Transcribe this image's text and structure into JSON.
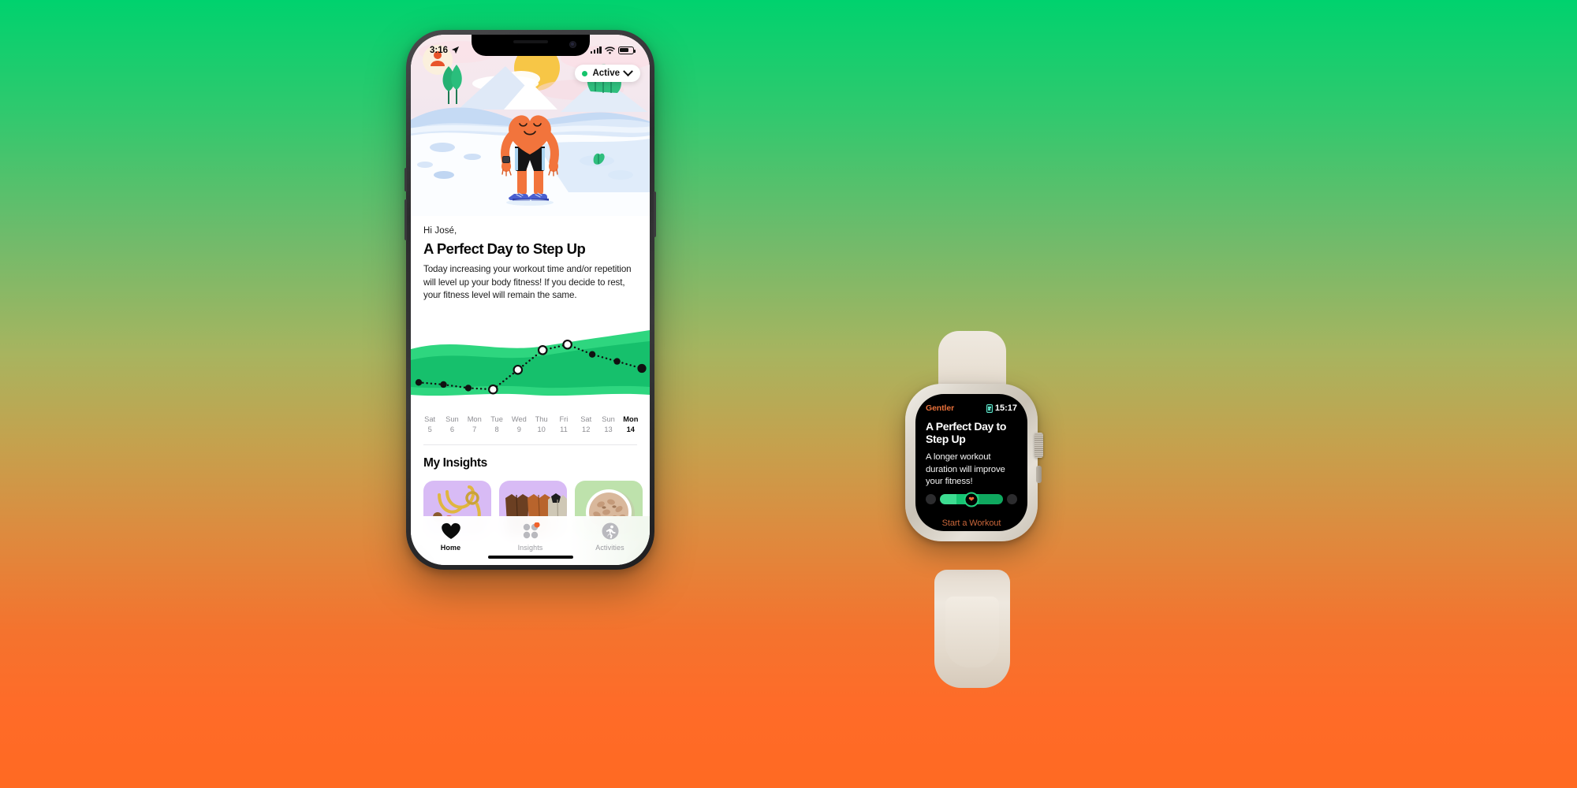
{
  "background": {
    "top_color": "#00D26E",
    "mid_color": "#C4A24E",
    "bottom_color": "#FF6B28"
  },
  "phone": {
    "status_bar": {
      "time": "3:16",
      "location_icon": "location-arrow-icon",
      "signal_icon": "cellular-signal-icon",
      "wifi_icon": "wifi-icon",
      "battery_icon": "battery-icon"
    },
    "hero": {
      "status_pill": {
        "label": "Active",
        "dot_color": "#14C46B",
        "chevron": "chevron-down-icon"
      },
      "character": "heart-mascot-illustration"
    },
    "greeting": "Hi José,",
    "headline": "A Perfect Day to Step Up",
    "body": "Today increasing your workout time and/or repetition will level up your body fitness! If you decide to rest, your fitness level will remain the same.",
    "insights": {
      "title": "My Insights",
      "cards": [
        {
          "name": "stethoscope-card",
          "bg": "#D8BBF5"
        },
        {
          "name": "coats-card",
          "bg": "#D8BBF5"
        },
        {
          "name": "nuts-bowl-card",
          "bg": "#BEE2AC"
        },
        {
          "name": "partial-card",
          "bg": "#C7E8B5"
        }
      ]
    },
    "tabs": [
      {
        "label": "Home",
        "icon": "heart-icon",
        "active": true,
        "badge": ""
      },
      {
        "label": "Insights",
        "icon": "grid-dots-icon",
        "active": false,
        "badge": "dot"
      },
      {
        "label": "Activities",
        "icon": "running-person-icon",
        "active": false,
        "badge": ""
      }
    ]
  },
  "chart_data": {
    "type": "line",
    "title": "",
    "xlabel": "",
    "ylabel": "",
    "grid": false,
    "legend": "none",
    "categories": [
      "Sat 5",
      "Sun 6",
      "Mon 7",
      "Tue 8",
      "Wed 9",
      "Thu 10",
      "Fri 11",
      "Sat 12",
      "Sun 13",
      "Mon 14"
    ],
    "day_names": [
      "Sat",
      "Sun",
      "Mon",
      "Tue",
      "Wed",
      "Thu",
      "Fri",
      "Sat",
      "Sun",
      "Mon"
    ],
    "day_numbers": [
      "5",
      "6",
      "7",
      "8",
      "9",
      "10",
      "11",
      "12",
      "13",
      "14"
    ],
    "selected_index": 9,
    "values": [
      30,
      27,
      22,
      20,
      48,
      76,
      84,
      70,
      60,
      50
    ],
    "ylim": [
      0,
      100
    ],
    "point_styles": [
      "filled",
      "filled",
      "filled",
      "hollow",
      "hollow",
      "hollow",
      "hollow",
      "filled",
      "filled",
      "filled-large"
    ],
    "line_style": "dotted",
    "band_colors": [
      "#2ED67F",
      "#16C06C"
    ],
    "point_color": "#111111"
  },
  "watch": {
    "app_name": "Gentler",
    "time": "15:17",
    "status_icon": "app-indicator-icon",
    "headline": "A Perfect Day to Step Up",
    "body": "A longer workout duration will improve your fitness!",
    "slider": {
      "knob_icon": "heart-icon",
      "value_percent": 50,
      "track_color": "#16C473"
    },
    "action": "Start a Workout",
    "accent_color": "#E8703A"
  }
}
